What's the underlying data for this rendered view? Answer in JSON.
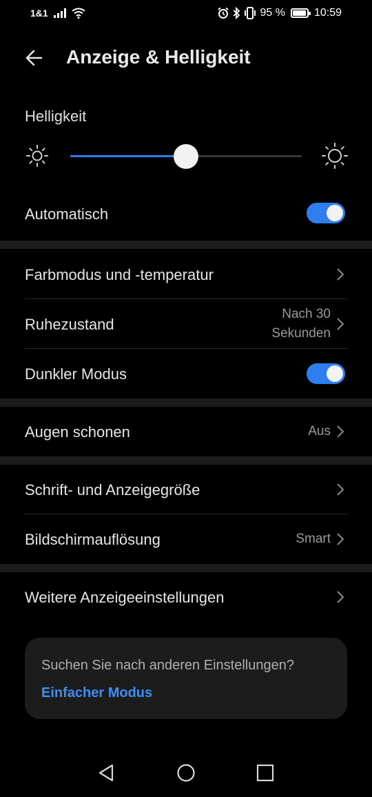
{
  "status": {
    "carrier": "1&1",
    "battery_text": "95 %",
    "battery_level": 0.95,
    "time": "10:59"
  },
  "header": {
    "title": "Anzeige & Helligkeit"
  },
  "brightness": {
    "label": "Helligkeit",
    "level": 0.5
  },
  "auto": {
    "label": "Automatisch",
    "on": true
  },
  "rows": {
    "farbmodus": {
      "label": "Farbmodus und -temperatur"
    },
    "ruhezustand": {
      "label": "Ruhezustand",
      "value_line1": "Nach 30",
      "value_line2": "Sekunden"
    },
    "dunkler": {
      "label": "Dunkler Modus",
      "on": true
    },
    "augen": {
      "label": "Augen schonen",
      "value": "Aus"
    },
    "schrift": {
      "label": "Schrift- und Anzeigegröße"
    },
    "aufloesung": {
      "label": "Bildschirmauflösung",
      "value": "Smart"
    },
    "weitere": {
      "label": "Weitere Anzeigeeinstellungen"
    }
  },
  "search_card": {
    "question": "Suchen Sie nach anderen Einstellungen?",
    "link": "Einfacher Modus"
  },
  "colors": {
    "accent": "#2e7ef0",
    "link": "#3d8ff5",
    "background": "#000000",
    "card": "#1c1c1c"
  }
}
